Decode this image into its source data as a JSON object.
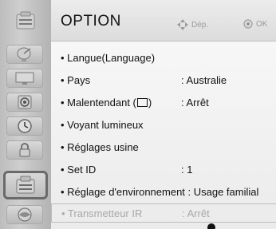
{
  "header": {
    "title": "OPTION",
    "nav_hint": "Dép.",
    "ok_hint": "OK"
  },
  "sidebar": {
    "items": [
      {
        "icon": "satellite-dish-icon"
      },
      {
        "icon": "tv-picture-icon"
      },
      {
        "icon": "speaker-audio-icon"
      },
      {
        "icon": "clock-time-icon"
      },
      {
        "icon": "lock-icon"
      },
      {
        "icon": "option-menu-icon",
        "active": true
      },
      {
        "icon": "network-globe-icon"
      }
    ]
  },
  "menu": {
    "rows": [
      {
        "label": "• Langue(Language)",
        "value": ""
      },
      {
        "label": "• Pays",
        "value": ": Australie"
      },
      {
        "label_pre": "• Malentendant (",
        "label_post": ")",
        "value": ": Arrêt"
      },
      {
        "label": "• Voyant lumineux",
        "value": ""
      },
      {
        "label": "• Réglages usine",
        "value": ""
      },
      {
        "label": "• Set ID",
        "value": ": 1"
      },
      {
        "label": "• Réglage d'environnement : Usage familial",
        "value": ""
      },
      {
        "label": "• Transmetteur IR",
        "value": ": Arrêt",
        "disabled": true
      }
    ]
  }
}
